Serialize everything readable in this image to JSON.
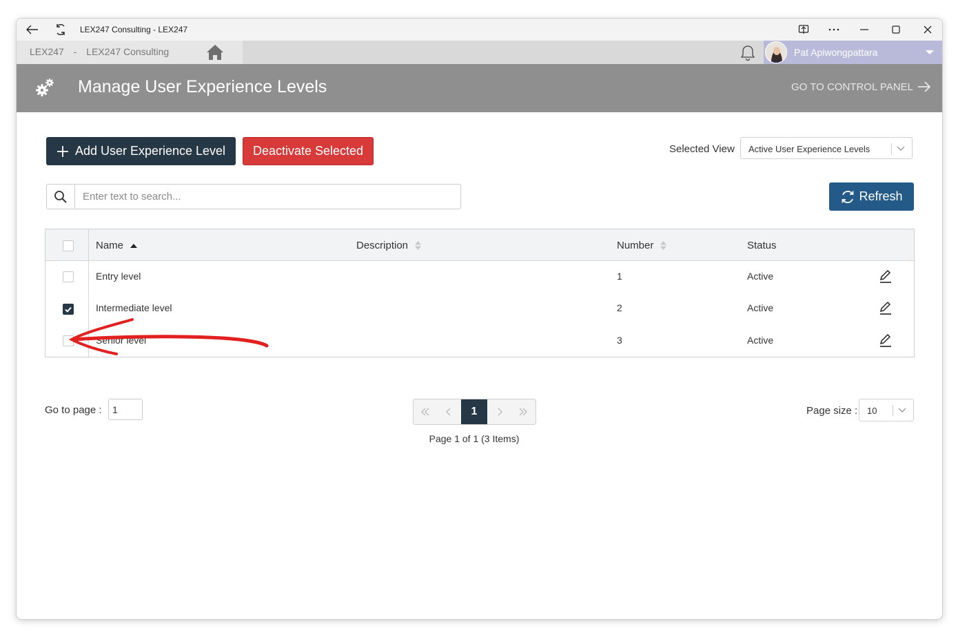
{
  "window": {
    "title": "LEX247 Consulting - LEX247",
    "icons": [
      "back-arrow-icon",
      "reload-icon",
      "cast-icon",
      "more-icon",
      "minimize-icon",
      "maximize-icon",
      "close-icon"
    ]
  },
  "appbar": {
    "tenant_code": "LEX247",
    "tenant_sep": "-",
    "tenant_name": "LEX247 Consulting",
    "user_name": "Pat Apiwongpattara",
    "colors": {
      "user_bg": "#b9b9d9",
      "bar_bg": "#d9d9d9"
    }
  },
  "header": {
    "title": "Manage User Experience Levels",
    "control_panel_link": "GO TO CONTROL PANEL",
    "bg_color": "#8f8f8f"
  },
  "toolbar": {
    "add_label": "Add User Experience Level",
    "deactivate_label": "Deactivate Selected",
    "selected_view_label": "Selected View",
    "selected_view_value": "Active User Experience Levels",
    "search_placeholder": "Enter text to search...",
    "refresh_label": "Refresh",
    "colors": {
      "add": "#263746",
      "deactivate": "#d83a3a",
      "refresh": "#235a87"
    }
  },
  "table": {
    "columns": {
      "name": "Name",
      "description": "Description",
      "number": "Number",
      "status": "Status"
    },
    "rows": [
      {
        "checked": false,
        "name": "Entry level",
        "description": "",
        "number": "1",
        "status": "Active"
      },
      {
        "checked": true,
        "name": "Intermediate level",
        "description": "",
        "number": "2",
        "status": "Active"
      },
      {
        "checked": false,
        "name": "Senior level",
        "description": "",
        "number": "3",
        "status": "Active"
      }
    ]
  },
  "pager": {
    "goto_label": "Go to page :",
    "goto_value": "1",
    "current_page": "1",
    "info": "Page 1 of 1 (3 Items)",
    "page_size_label": "Page size :",
    "page_size_value": "10"
  },
  "annotation": {
    "color": "#e32020"
  }
}
